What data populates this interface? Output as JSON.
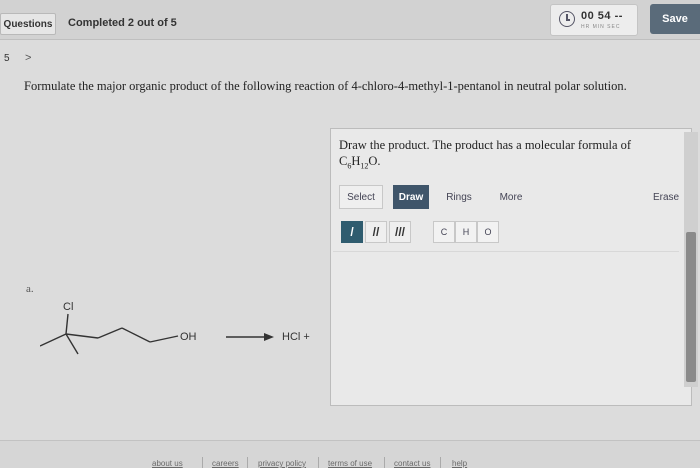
{
  "header": {
    "questions_label": "Questions",
    "completed_text": "Completed 2 out of 5",
    "timer_value": "00 54 --",
    "timer_units": "HR  MIN  SEC",
    "save_label": "Save"
  },
  "nav": {
    "question_number": "5",
    "next_symbol": ">"
  },
  "question": {
    "prompt": "Formulate the major organic product of the following reaction of 4-chloro-4-methyl-1-pentanol in neutral polar solution.",
    "part_label": "a."
  },
  "panel": {
    "instruction": "Draw the product. The product has a molecular formula of",
    "formula": {
      "c": "C",
      "c_sub": "6",
      "h": "H",
      "h_sub": "12",
      "o": "O."
    },
    "tools": {
      "select": "Select",
      "draw": "Draw",
      "rings": "Rings",
      "more": "More",
      "erase": "Erase"
    },
    "bonds": {
      "single": "/",
      "double": "//",
      "triple": "///"
    },
    "atoms": {
      "c": "C",
      "h": "H",
      "o": "O"
    }
  },
  "reaction": {
    "cl_label": "Cl",
    "oh_label": "OH",
    "reagent": "HCl +"
  },
  "footer": {
    "links": [
      "about us",
      "careers",
      "privacy policy",
      "terms of use",
      "contact us",
      "help"
    ]
  },
  "icons": {
    "timer": "clock-icon",
    "arrow": "reaction-arrow-icon"
  }
}
